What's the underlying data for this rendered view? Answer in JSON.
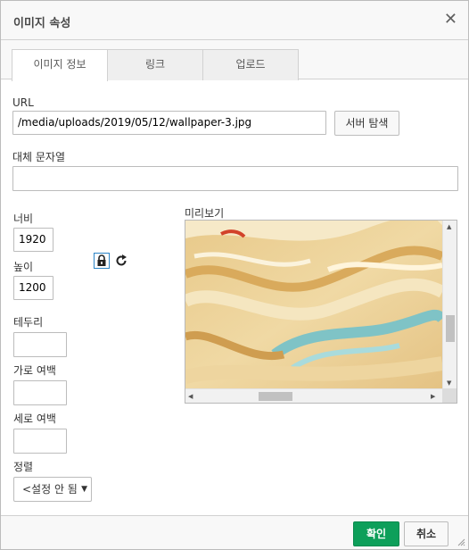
{
  "dialog": {
    "title": "이미지 속성",
    "close_icon": "close-icon"
  },
  "tabs": [
    {
      "label": "이미지 정보",
      "active": true
    },
    {
      "label": "링크",
      "active": false
    },
    {
      "label": "업로드",
      "active": false
    }
  ],
  "form": {
    "url_label": "URL",
    "url_value": "/media/uploads/2019/05/12/wallpaper-3.jpg",
    "browse_label": "서버 탐색",
    "alt_label": "대체 문자열",
    "alt_value": "",
    "width_label": "너비",
    "width_value": "1920",
    "height_label": "높이",
    "height_value": "1200",
    "border_label": "테두리",
    "border_value": "",
    "hspace_label": "가로 여백",
    "hspace_value": "",
    "vspace_label": "세로 여백",
    "vspace_value": "",
    "align_label": "정렬",
    "align_value": "<설정 안 됨"
  },
  "preview": {
    "label": "미리보기"
  },
  "footer": {
    "ok_label": "확인",
    "cancel_label": "취소"
  },
  "colors": {
    "ok_button": "#0d9f5a",
    "lock_border": "#2b84c6"
  }
}
